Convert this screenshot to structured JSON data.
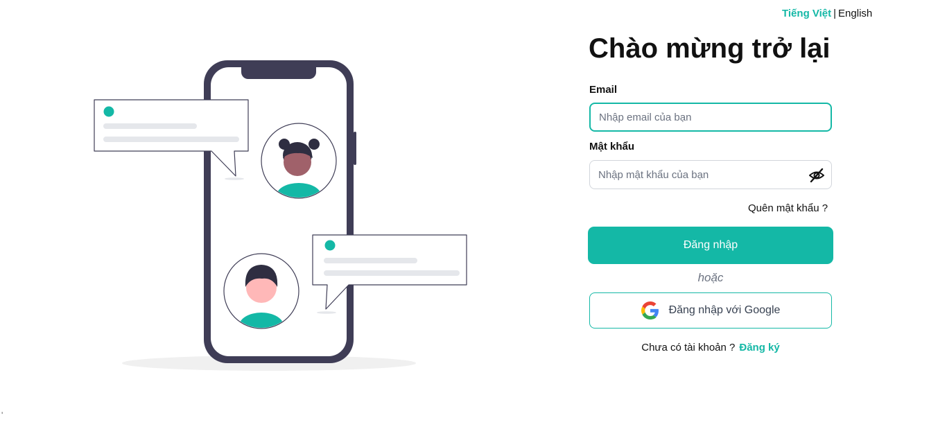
{
  "language": {
    "active": "Tiếng Việt",
    "separator": "|",
    "other": "English"
  },
  "login": {
    "title": "Chào mừng trở lại",
    "email_label": "Email",
    "email_placeholder": "Nhập email của bạn",
    "email_value": "",
    "password_label": "Mật khẩu",
    "password_placeholder": "Nhập mật khẩu của bạn",
    "password_value": "",
    "password_toggle_icon": "eye-off-icon",
    "forgot_password": "Quên mật khẩu ?",
    "submit_label": "Đăng nhập",
    "divider_text": "hoặc",
    "google_label": "Đăng nhập với Google",
    "google_icon": "google-icon",
    "no_account_text": "Chưa có tài khoản ?",
    "signup_link": "Đăng ký"
  },
  "stray_mark": "'",
  "colors": {
    "accent": "#14b8a6",
    "phone_frame": "#3f3d56",
    "bubble_line": "#e5e7eb",
    "skin_dark": "#a0616a",
    "skin_light": "#ffb8b8",
    "hair": "#2f2e41"
  }
}
